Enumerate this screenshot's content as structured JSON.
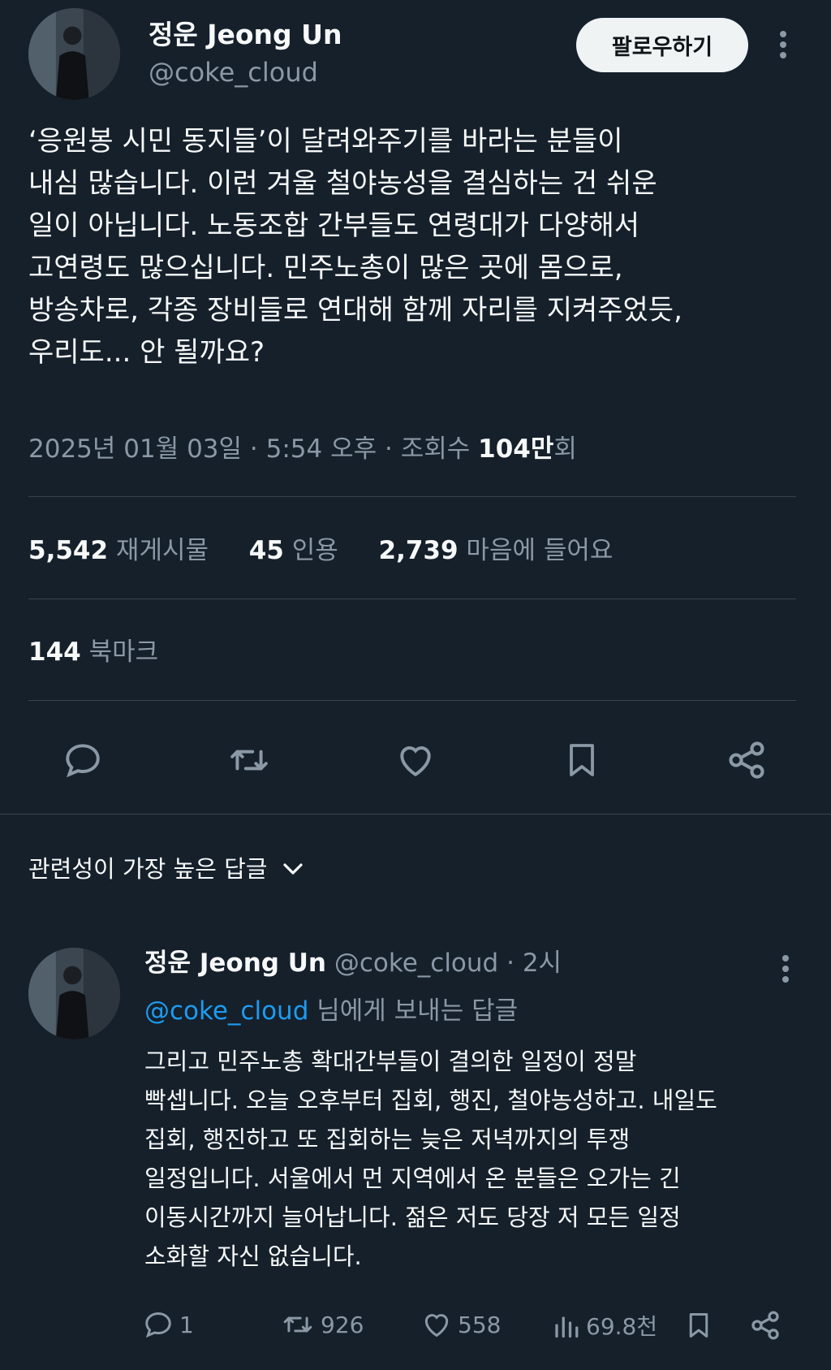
{
  "tweet": {
    "author_name": "정운 Jeong Un",
    "handle": "@coke_cloud",
    "follow_label": "팔로우하기",
    "text": "‘응원봉 시민 동지들’이 달려와주기를 바라는 분들이\n내심 많습니다. 이런 겨울 철야농성을 결심하는 건 쉬운\n일이 아닙니다. 노동조합 간부들도 연령대가 다양해서\n고연령도 많으십니다. 민주노총이 많은 곳에 몸으로,\n방송차로, 각종 장비들로 연대해 함께 자리를 지켜주었듯,\n우리도... 안 될까요?",
    "date": "2025년 01월 03일",
    "time": "5:54 오후",
    "separator": "·",
    "views_label_prefix": "조회수",
    "views_value": "104만",
    "views_label_suffix": "회"
  },
  "stats": {
    "reposts_value": "5,542",
    "reposts_label": "재게시물",
    "quotes_value": "45",
    "quotes_label": "인용",
    "likes_value": "2,739",
    "likes_label": "마음에 들어요",
    "bookmarks_value": "144",
    "bookmarks_label": "북마크"
  },
  "actions": {
    "icons": [
      "reply-icon",
      "repost-icon",
      "like-icon",
      "bookmark-icon",
      "share-icon"
    ]
  },
  "replies_sort": {
    "label": "관련성이 가장 높은 답글",
    "icon": "chevron-down-icon"
  },
  "reply": {
    "author_name": "정운 Jeong Un",
    "handle": "@coke_cloud",
    "separator": "·",
    "time": "2시",
    "reply_to_handle": "@coke_cloud",
    "reply_to_suffix": "님에게 보내는 답글",
    "text": "그리고 민주노총 확대간부들이 결의한 일정이 정말\n빡셉니다. 오늘 오후부터 집회, 행진, 철야농성하고. 내일도\n집회, 행진하고 또 집회하는 늦은 저녁까지의 투쟁\n일정입니다. 서울에서 먼 지역에서 온 분들은 오가는 긴\n이동시간까지 늘어납니다. 젊은 저도 당장 저 모든 일정\n소화할 자신 없습니다.",
    "reply_count": "1",
    "repost_count": "926",
    "like_count": "558",
    "view_count": "69.8천"
  },
  "colors": {
    "background": "#15202b",
    "text": "#f7f9f9",
    "muted": "#8b98a5",
    "link": "#1d9bf0",
    "divider": "#38444d",
    "follow_button_bg": "#eff3f4"
  }
}
